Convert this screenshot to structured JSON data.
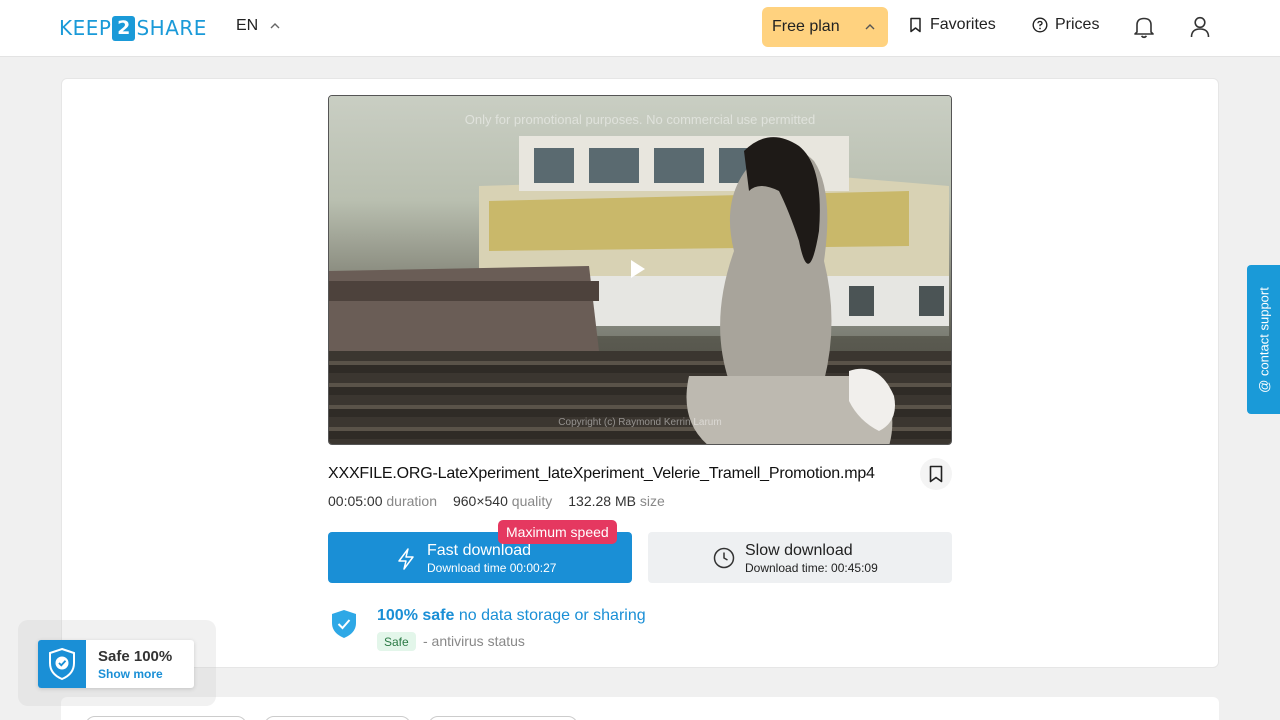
{
  "header": {
    "logo": {
      "pre": "KEEP",
      "num": "2",
      "post": "SHARE"
    },
    "language": "EN",
    "free_plan_label": "Free plan",
    "favorites_label": "Favorites",
    "prices_label": "Prices"
  },
  "video": {
    "watermark_top": "Only for promotional purposes. No commercial use permitted",
    "watermark_bottom": "Copyright (c) Raymond Kerrin Larum"
  },
  "file": {
    "name": "XXXFILE.ORG-LateXperiment_lateXperiment_Velerie_Tramell_Promotion.mp4",
    "duration_value": "00:05:00",
    "duration_label": "duration",
    "quality_value": "960×540",
    "quality_label": "quality",
    "size_value": "132.28 MB",
    "size_label": "size"
  },
  "download": {
    "max_speed_badge": "Maximum speed",
    "fast_title": "Fast download",
    "fast_sub": "Download time 00:00:27",
    "slow_title": "Slow download",
    "slow_sub": "Download time: 00:45:09"
  },
  "safety": {
    "bold": "100% safe",
    "rest": "no data storage or sharing",
    "tag": "Safe",
    "status": "- antivirus status"
  },
  "contact_support": "@ contact support",
  "safe_widget": {
    "title": "Safe 100%",
    "link": "Show more"
  },
  "colors": {
    "accent": "#1a8fd6",
    "free_plan": "#ffd27f",
    "badge": "#e53860"
  }
}
